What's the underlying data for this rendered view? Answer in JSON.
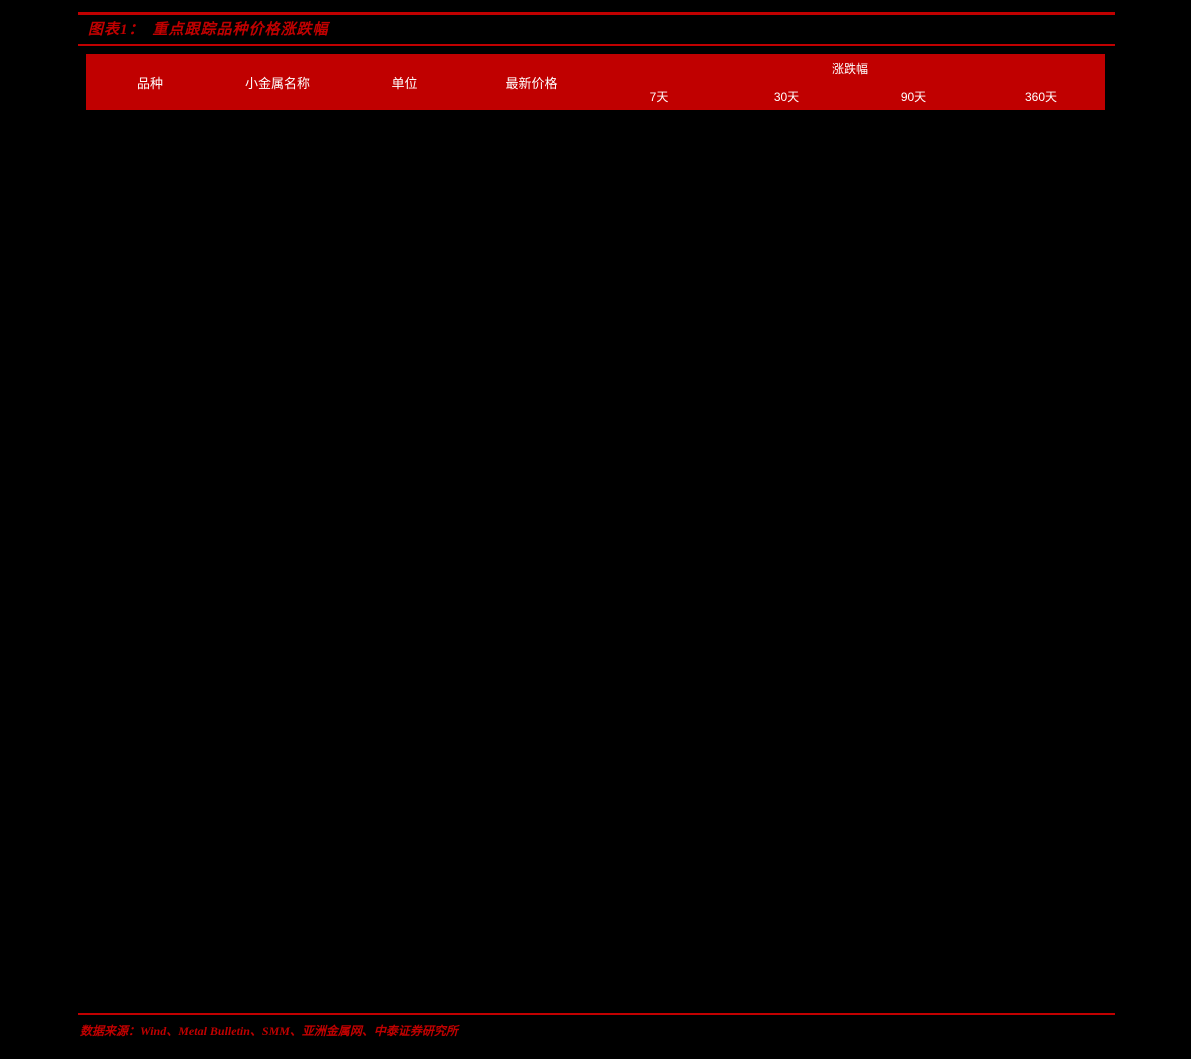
{
  "figure": {
    "caption_label": "图表1：",
    "caption_text": "重点跟踪品种价格涨跌幅",
    "accent_color": "#C00000",
    "header_bg_color": "#C00000",
    "header_text_color": "#FFFFFF",
    "background_color": "#000000"
  },
  "table": {
    "columns": [
      {
        "label": "品种"
      },
      {
        "label": "小金属名称"
      },
      {
        "label": "单位"
      },
      {
        "label": "最新价格"
      }
    ],
    "group_header": {
      "label": "涨跌幅"
    },
    "sub_columns": [
      {
        "label": "7天"
      },
      {
        "label": "30天"
      },
      {
        "label": "90天"
      },
      {
        "label": "360天"
      }
    ],
    "rows": []
  },
  "footer": {
    "source_note": "数据来源：Wind、Metal Bulletin、SMM、亚洲金属网、中泰证券研究所"
  }
}
